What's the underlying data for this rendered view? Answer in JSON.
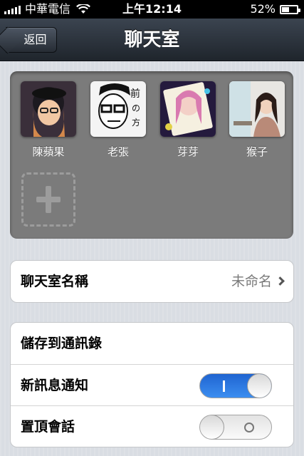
{
  "status_bar": {
    "carrier": "中華電信",
    "time": "上午12:14",
    "battery_text": "52%",
    "battery_level": 0.52
  },
  "nav": {
    "back_label": "返回",
    "title": "聊天室"
  },
  "members": [
    {
      "name": "陳蘋果",
      "avatar_colors": [
        "#2a2630",
        "#e8b37a",
        "#5a3f60"
      ]
    },
    {
      "name": "老張",
      "avatar_colors": [
        "#f2f2f2",
        "#1a1a1a",
        "#8a8a8a"
      ]
    },
    {
      "name": "芽芽",
      "avatar_colors": [
        "#2d1d4a",
        "#e89ac4",
        "#d4c14a"
      ]
    },
    {
      "name": "猴子",
      "avatar_colors": [
        "#e7e2dc",
        "#3a2a24",
        "#c9b9a8"
      ]
    }
  ],
  "chatroom_name": {
    "label": "聊天室名稱",
    "value": "未命名"
  },
  "settings": {
    "save_contacts": "儲存到通訊錄",
    "new_message_notify": "新訊息通知",
    "pin_chat": "置頂會話"
  },
  "toggles": {
    "new_message_notify_on": true,
    "pin_chat_on": false
  },
  "colors": {
    "toggle_on": "#2f7ce8",
    "panel_bg": "#7b7b7b"
  }
}
